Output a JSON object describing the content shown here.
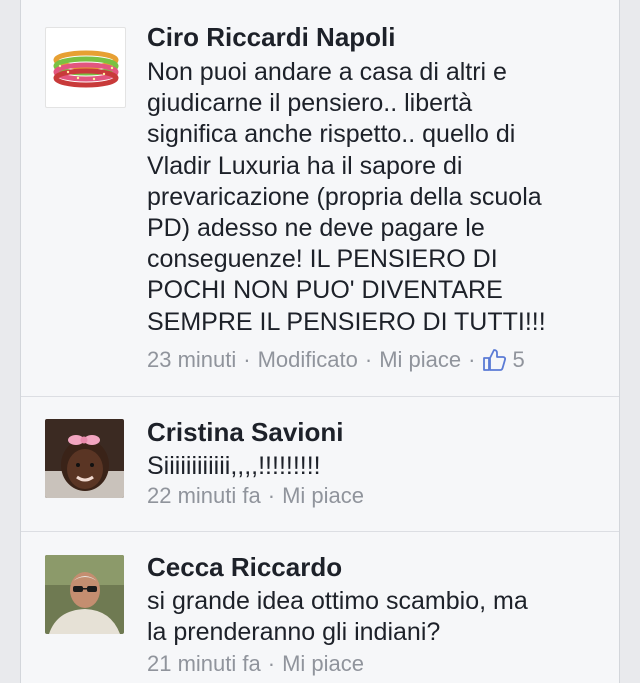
{
  "comments": [
    {
      "author": "Ciro Riccardi Napoli",
      "text_lines": [
        "Non puoi andare a casa di altri e",
        "giudicarne il pensiero.. libertà",
        "significa anche rispetto.. quello di",
        "Vladir Luxuria ha il sapore di",
        "prevaricazione (propria della scuola",
        "PD) adesso ne deve pagare le",
        "conseguenze! IL PENSIERO DI",
        "POCHI NON PUO' DIVENTARE",
        "SEMPRE IL PENSIERO DI TUTTI!!!"
      ],
      "time": "23 minuti",
      "edited_label": "Modificato",
      "like_label": "Mi piace",
      "like_count": "5"
    },
    {
      "author": "Cristina Savioni",
      "text_lines": [
        "Siiiiiiiiiiii,,,,!!!!!!!!!"
      ],
      "time": "22 minuti fa",
      "like_label": "Mi piace"
    },
    {
      "author": "Cecca Riccardo",
      "text_lines": [
        "si grande idea ottimo scambio, ma",
        "la prenderanno gli indiani?"
      ],
      "time": "21 minuti fa",
      "like_label": "Mi piace"
    }
  ],
  "separator": "·",
  "colors": {
    "background": "#e9eaed",
    "card": "#f6f7f9",
    "text": "#1d2129",
    "meta": "#90949c",
    "like_icon": "#5b7bd5"
  }
}
